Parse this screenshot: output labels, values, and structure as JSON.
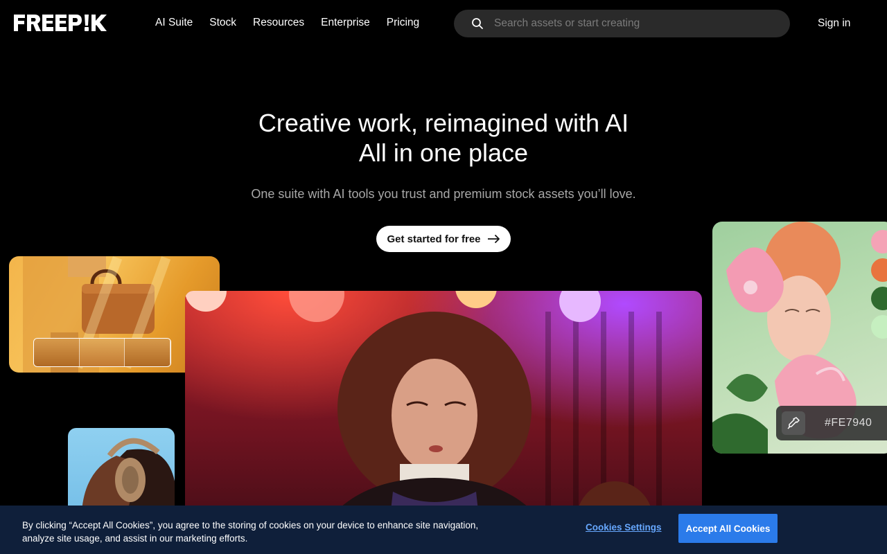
{
  "header": {
    "logo_text": "FREEPIK",
    "nav": [
      "AI Suite",
      "Stock",
      "Resources",
      "Enterprise",
      "Pricing"
    ],
    "search_placeholder": "Search assets or start creating",
    "signin_label": "Sign in"
  },
  "hero": {
    "title_line1": "Creative work, reimagined with AI",
    "title_line2": "All in one place",
    "subtitle": "One suite with AI tools you trust and premium stock assets you’ll love.",
    "cta_label": "Get started for free"
  },
  "showcase": {
    "color_picker_value": "#FE7940",
    "swatch_colors": [
      "#f4a3b6",
      "#e8743e",
      "#2f6a2e",
      "#c6efc0"
    ]
  },
  "cookie_banner": {
    "text": "By clicking “Accept All Cookies”, you agree to the storing of cookies on your device to enhance site navigation, analyze site usage, and assist in our marketing efforts.",
    "settings_label": "Cookies Settings",
    "accept_label": "Accept All Cookies"
  }
}
